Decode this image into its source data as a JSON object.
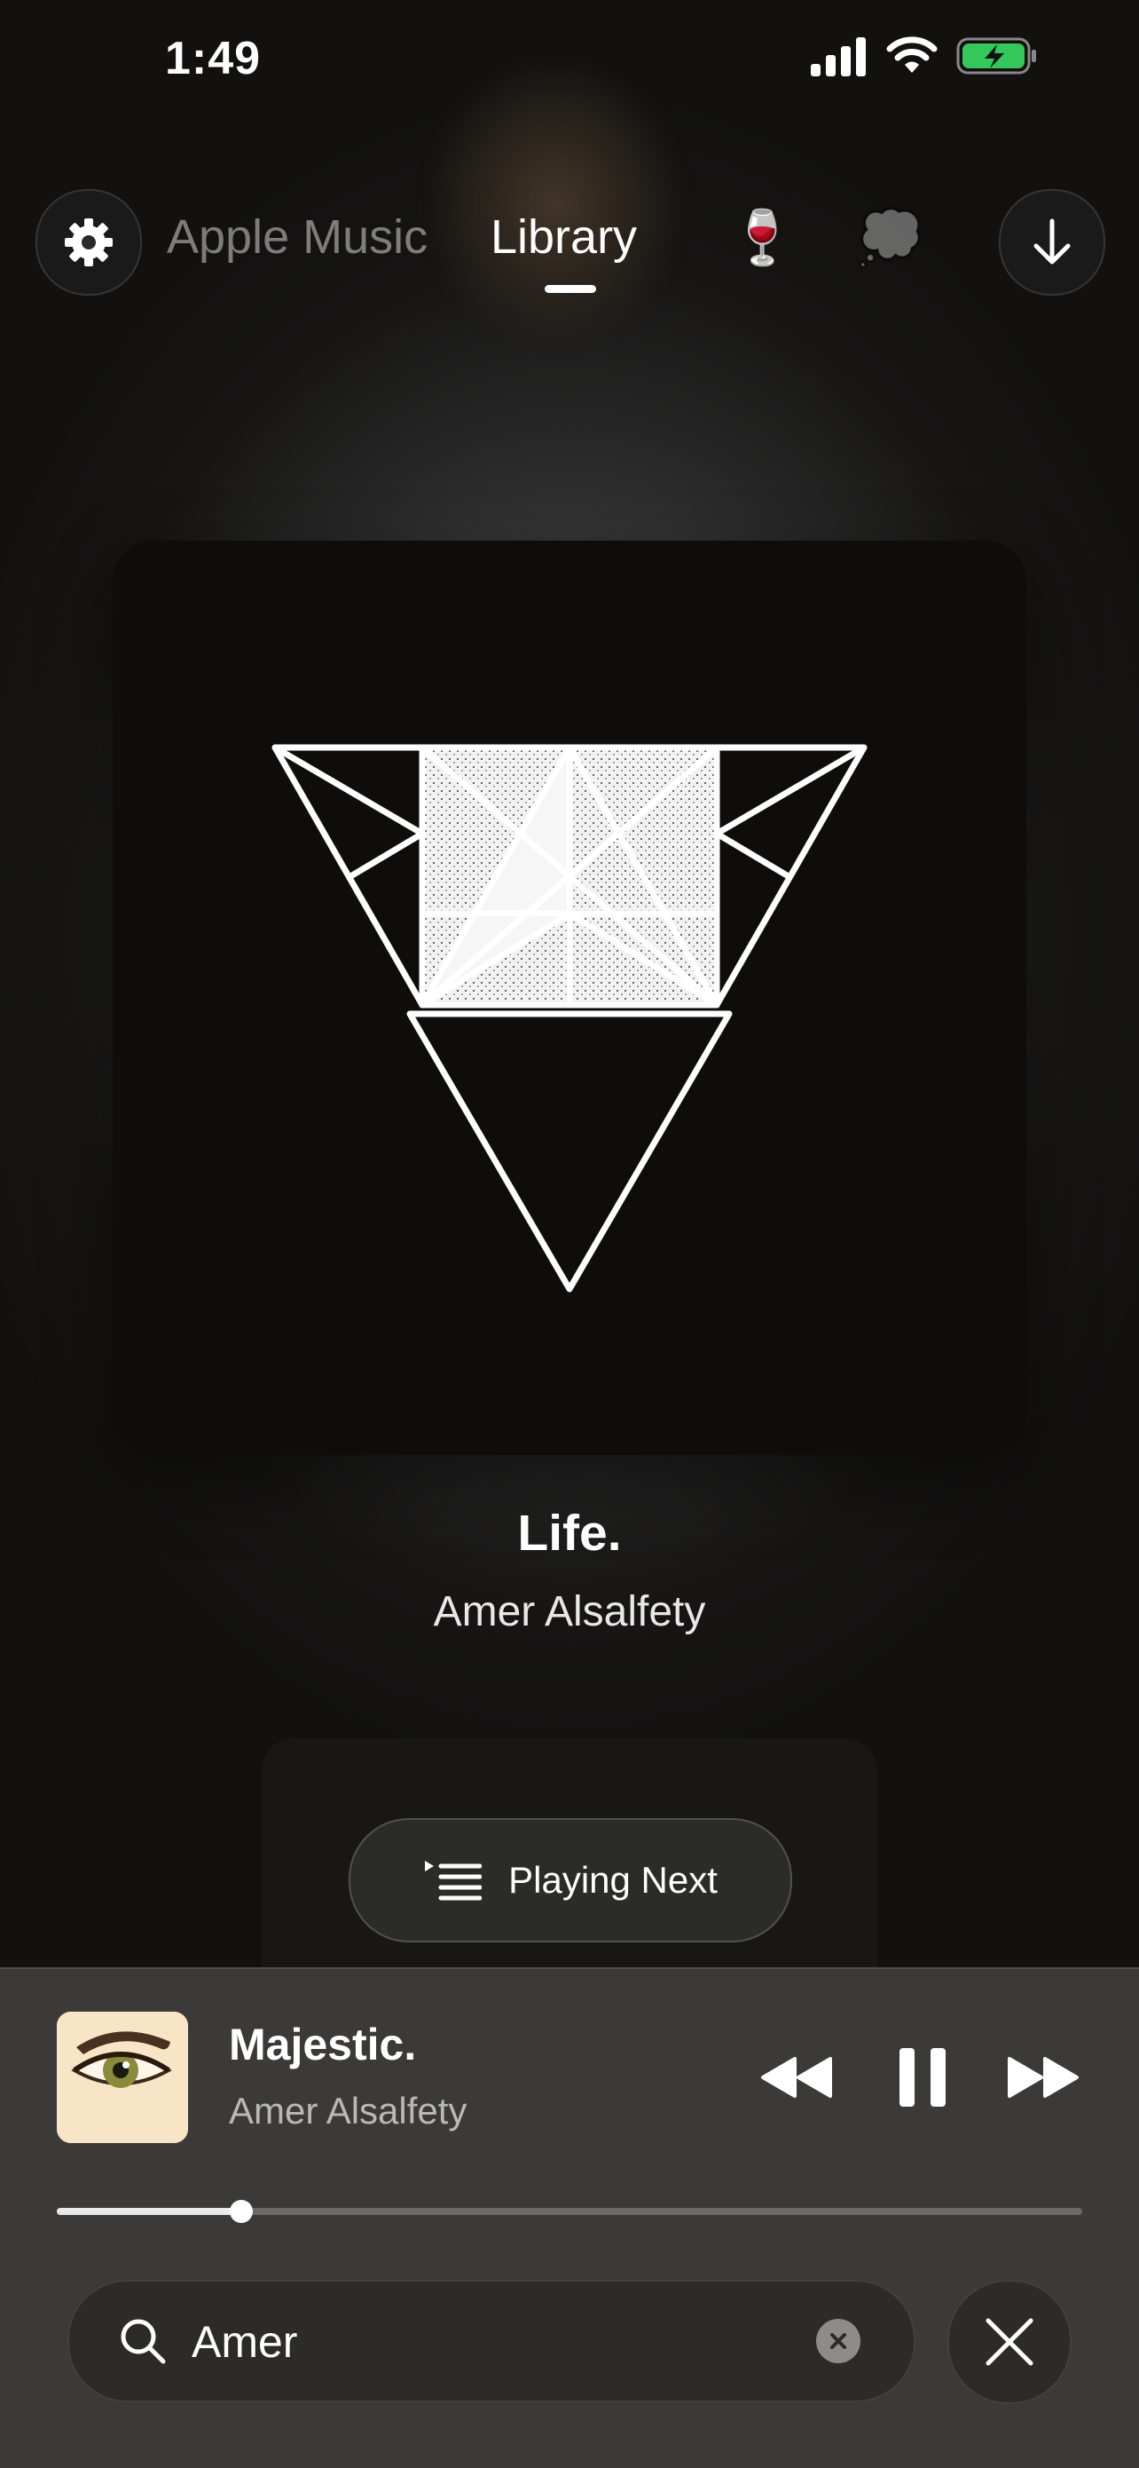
{
  "status_bar": {
    "time": "1:49"
  },
  "nav": {
    "tabs": [
      {
        "label": "Apple Music",
        "selected": false
      },
      {
        "label": "Library",
        "selected": true
      },
      {
        "label": "🍷",
        "selected": false
      },
      {
        "label": "💭",
        "selected": false
      }
    ]
  },
  "now_showing": {
    "title": "Life.",
    "artist": "Amer Alsalfety"
  },
  "playing_next": {
    "label": "Playing Next"
  },
  "mini_player": {
    "title": "Majestic.",
    "artist": "Amer Alsalfety",
    "progress": 0.18
  },
  "search": {
    "value": "Amer"
  },
  "colors": {
    "background": "#141312",
    "mini_player": "#3b3a39",
    "accent": "#ffffff"
  }
}
